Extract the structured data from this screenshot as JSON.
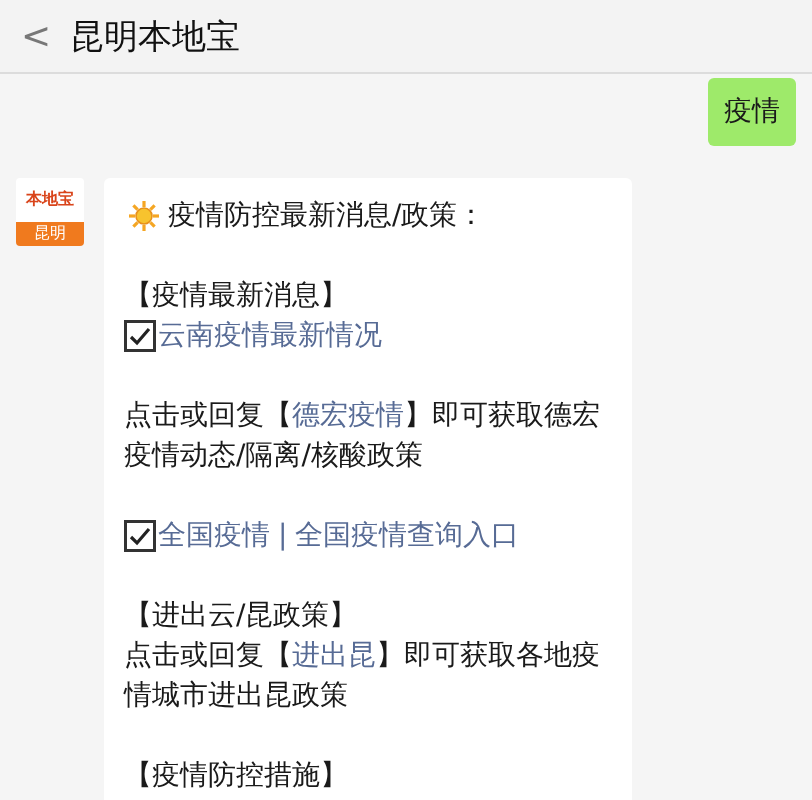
{
  "header": {
    "back": "<",
    "title": "昆明本地宝"
  },
  "messages": [
    {
      "kind": "sent",
      "text": "疫情"
    },
    {
      "kind": "received",
      "avatar": {
        "brand": "本地宝",
        "city": "昆明"
      },
      "sections": [
        {
          "lines": [
            {
              "kind": "intro",
              "text": "疫情防控最新消息/政策："
            }
          ]
        },
        {
          "lines": [
            {
              "kind": "heading",
              "text": "【疫情最新消息】"
            },
            {
              "kind": "checklink",
              "checked": true,
              "parts": [
                {
                  "text": "云南疫情最新情况",
                  "kind": "link"
                }
              ]
            }
          ]
        },
        {
          "lines": [
            {
              "kind": "sentence",
              "parts": [
                {
                  "text": "点击或回复【",
                  "kind": "text"
                },
                {
                  "text": "德宏疫情",
                  "kind": "link"
                },
                {
                  "text": "】即可获取德宏疫情动态/隔离/核酸政策",
                  "kind": "text"
                }
              ]
            }
          ]
        },
        {
          "lines": [
            {
              "kind": "checklink",
              "checked": true,
              "parts": [
                {
                  "text": "全国疫情",
                  "kind": "link"
                },
                {
                  "text": "|",
                  "kind": "text"
                },
                {
                  "text": "全国疫情查询入口",
                  "kind": "link"
                }
              ]
            }
          ]
        },
        {
          "lines": [
            {
              "kind": "heading",
              "text": "【进出云/昆政策】"
            },
            {
              "kind": "sentence",
              "parts": [
                {
                  "text": "点击或回复【",
                  "kind": "text"
                },
                {
                  "text": "进出昆",
                  "kind": "link"
                },
                {
                  "text": "】即可获取各地疫情城市进出昆政策",
                  "kind": "text"
                }
              ]
            }
          ]
        },
        {
          "lines": [
            {
              "kind": "heading",
              "text": "【疫情防控措施】"
            }
          ]
        }
      ]
    }
  ]
}
